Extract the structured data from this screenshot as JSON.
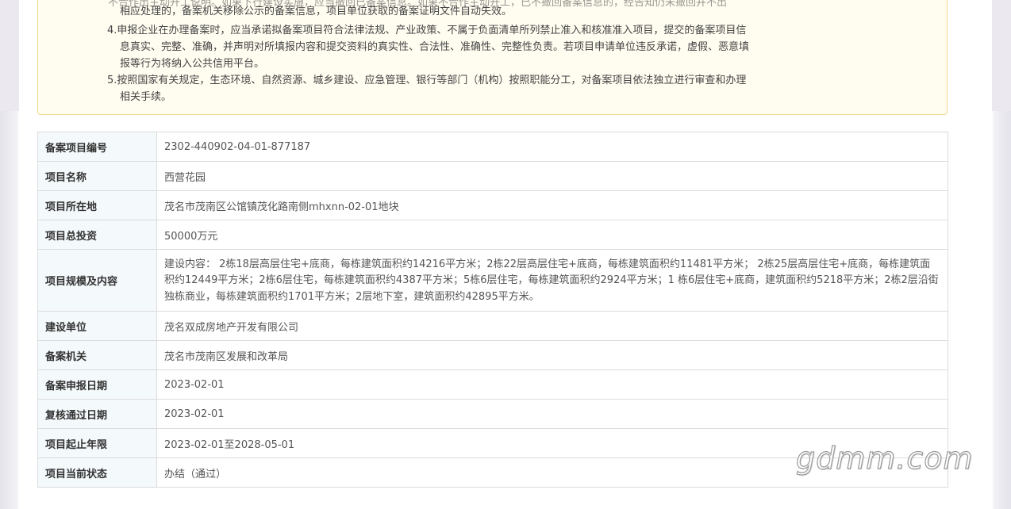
{
  "notice": {
    "lines": [
      "不合作出主动开工说明。如果下行建设实施，应当撤回已备案信息。如果不合作主动开工，已不撤回备案信息的，经告知仍未撤回并不出",
      "相应处理的，备案机关移除公示的备案信息，项目单位获取的备案证明文件自动失效。",
      "4.申报企业在办理备案时，应当承诺拟备案项目符合法律法规、产业政策、不属于负面清单所列禁止准入和核准准入项目，提交的备案项目信",
      "息真实、完整、准确，并声明对所填报内容和提交资料的真实性、合法性、准确性、完整性负责。若项目申请单位违反承诺，虚假、恶意填",
      "报等行为将纳入公共信用平台。",
      "5.按照国家有关规定，生态环境、自然资源、城乡建设、应急管理、银行等部门（机构）按照职能分工，对备案项目依法独立进行审查和办理",
      "相关手续。"
    ]
  },
  "record": {
    "rows": [
      {
        "label": "备案项目编号",
        "value": "2302-440902-04-01-877187"
      },
      {
        "label": "项目名称",
        "value": "西营花园"
      },
      {
        "label": "项目所在地",
        "value": "茂名市茂南区公馆镇茂化路南侧mhxnn-02-01地块"
      },
      {
        "label": "项目总投资",
        "value": "50000万元"
      },
      {
        "label": "项目规模及内容",
        "value": "建设内容： 2栋18层高层住宅+底商，每栋建筑面积约14216平方米；2栋22层高层住宅+底商，每栋建筑面积约11481平方米； 2栋25层高层住宅+底商，每栋建筑面积约12449平方米；2栋6层住宅，每栋建筑面积约4387平方米；5栋6层住宅，每栋建筑面积约2924平方米；1 栋6层住宅+底商，建筑面积约5218平方米；2栋2层沿街独栋商业，每栋建筑面积约1701平方米；2层地下室，建筑面积约42895平方米。"
      },
      {
        "label": "建设单位",
        "value": "茂名双成房地产开发有限公司"
      },
      {
        "label": "备案机关",
        "value": "茂名市茂南区发展和改革局"
      },
      {
        "label": "备案申报日期",
        "value": "2023-02-01"
      },
      {
        "label": "复核通过日期",
        "value": "2023-02-01"
      },
      {
        "label": "项目起止年限",
        "value": "2023-02-01至2028-05-01"
      },
      {
        "label": "项目当前状态",
        "value": "办结（通过）"
      }
    ]
  },
  "watermark": {
    "text": "gdmm.com"
  }
}
